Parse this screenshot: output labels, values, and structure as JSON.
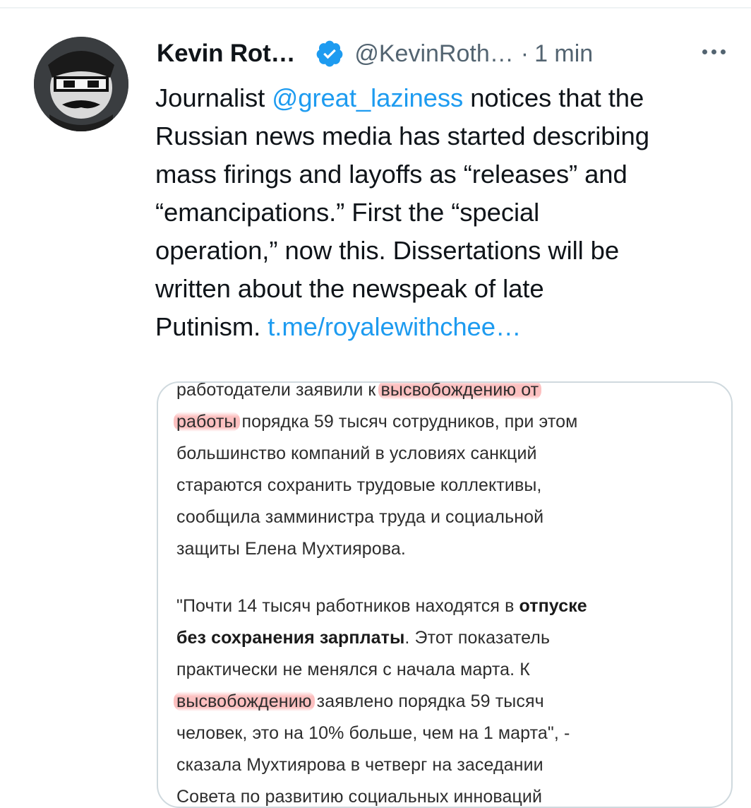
{
  "tweet": {
    "author_name": "Kevin Rot…",
    "handle": "@KevinRoth…",
    "separator": "·",
    "time": "1 min",
    "text_lines": [
      [
        "Journalist ",
        "@great_laziness",
        " notices that the"
      ],
      [
        "Russian news media has started describing"
      ],
      [
        "mass firings and layoffs as “releases” and"
      ],
      [
        "“emancipations.” First the “special"
      ],
      [
        "operation,” now this. Dissertations will be"
      ],
      [
        "written about the newspeak of late"
      ],
      [
        "Putinism. ",
        "t.me/royalewithchee…"
      ]
    ]
  },
  "media": {
    "l1a": "работодатели заявили к ",
    "l1b": "высвобождению от",
    "l2a": "работы",
    "l2b": " порядка 59 тысяч сотрудников, при этом",
    "l3": "большинство компаний в условиях санкций",
    "l4": "стараются сохранить трудовые коллективы,",
    "l5": "сообщила замминистра труда и социальной",
    "l6": "защиты Елена Мухтиярова.",
    "p2l1a": "\"Почти 14 тысяч работников находятся в ",
    "p2l1b": "отпуске",
    "p2l2a": "без сохранения зарплаты",
    "p2l2b": ". Этот показатель",
    "p2l3": "практически не менялся с начала марта. К",
    "p2l4a": "высвобождению",
    "p2l4b": " заявлено порядка 59 тысяч",
    "p2l5": "человек, это на 10% больше, чем на 1 марта\", -",
    "p2l6": "сказала Мухтиярова в четверг на заседании",
    "p2l7": "Совета по развитию социальных инноваций"
  },
  "icons": {
    "verified": "verified-badge-icon",
    "more": "more-dots-icon"
  },
  "colors": {
    "link": "#1d9bf0",
    "secondary_text": "#536471",
    "highlight": "#fa8c8c"
  }
}
